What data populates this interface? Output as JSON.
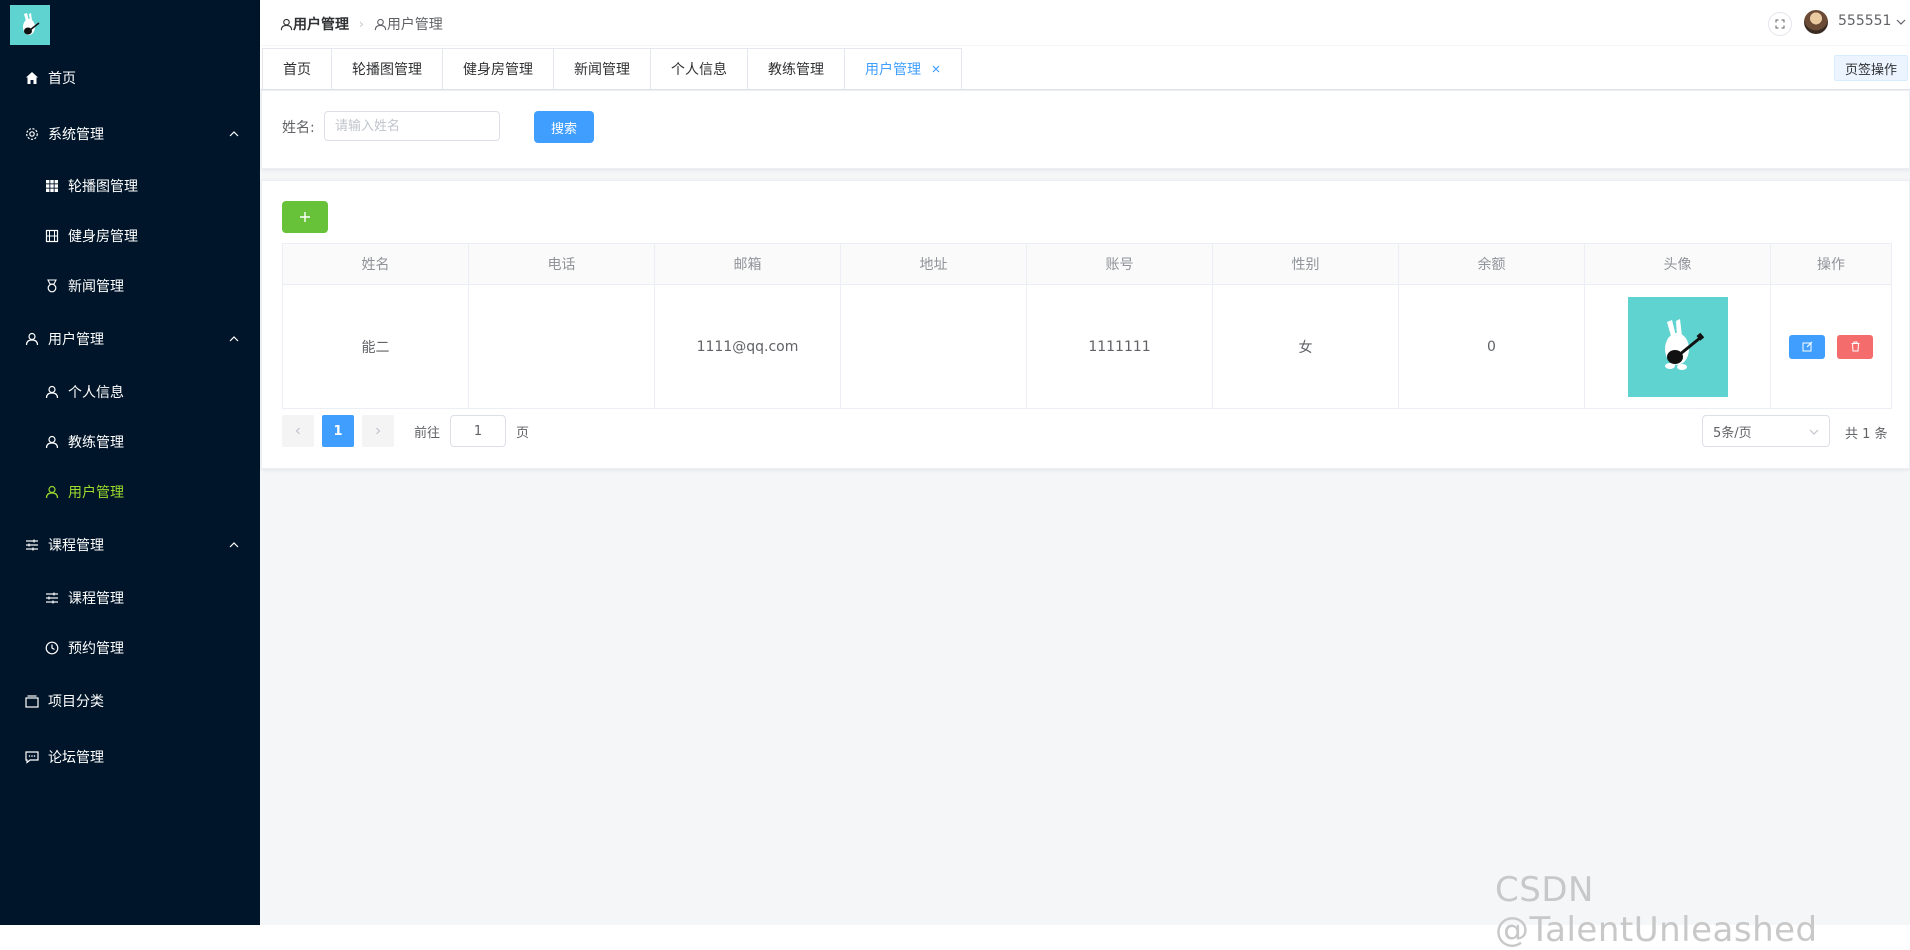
{
  "sidebar": {
    "items": [
      {
        "label": "首页",
        "icon": "home-icon"
      },
      {
        "label": "系统管理",
        "icon": "gear-icon"
      },
      {
        "label": "轮播图管理",
        "icon": "grid-icon"
      },
      {
        "label": "健身房管理",
        "icon": "film-icon"
      },
      {
        "label": "新闻管理",
        "icon": "medal-icon"
      },
      {
        "label": "用户管理",
        "icon": "user-icon"
      },
      {
        "label": "个人信息",
        "icon": "user-icon"
      },
      {
        "label": "教练管理",
        "icon": "user-icon"
      },
      {
        "label": "用户管理",
        "icon": "user-icon",
        "active": true
      },
      {
        "label": "课程管理",
        "icon": "sliders-icon"
      },
      {
        "label": "课程管理",
        "icon": "sliders-icon"
      },
      {
        "label": "预约管理",
        "icon": "clock-icon"
      },
      {
        "label": "项目分类",
        "icon": "box-icon"
      },
      {
        "label": "论坛管理",
        "icon": "chat-icon"
      }
    ]
  },
  "header": {
    "breadcrumb": [
      "用户管理",
      "用户管理"
    ],
    "username": "555551"
  },
  "tabs": {
    "items": [
      "首页",
      "轮播图管理",
      "健身房管理",
      "新闻管理",
      "个人信息",
      "教练管理",
      "用户管理"
    ],
    "active_index": 6,
    "page_actions": "页签操作"
  },
  "search": {
    "label": "姓名:",
    "placeholder": "请输入姓名",
    "button": "搜索"
  },
  "table": {
    "columns": [
      "姓名",
      "电话",
      "邮箱",
      "地址",
      "账号",
      "性别",
      "余额",
      "头像",
      "操作"
    ],
    "rows": [
      {
        "name": "能二",
        "phone": "",
        "email": "1111@qq.com",
        "address": "",
        "account": "1111111",
        "gender": "女",
        "balance": "0"
      }
    ]
  },
  "pagination": {
    "current": "1",
    "goto_label": "前往",
    "goto_value": "1",
    "page_unit": "页",
    "page_size": "5条/页",
    "total": "共 1 条"
  },
  "watermark": "CSDN @TalentUnleashed",
  "colors": {
    "sidebar_bg": "#001529",
    "primary": "#409eff",
    "success": "#67c23a",
    "danger": "#f56c6c",
    "active_menu": "#9bdc2e",
    "avatar_bg": "#5fd3cf"
  }
}
